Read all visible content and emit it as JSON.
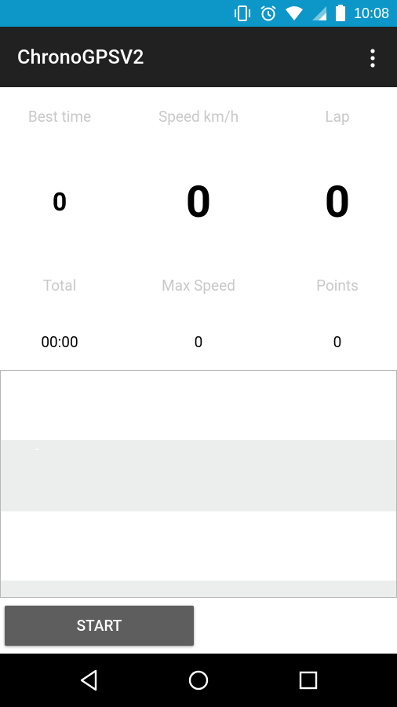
{
  "status_bar": {
    "time": "10:08",
    "icons": [
      "vibrate-icon",
      "alarm-icon",
      "wifi-icon",
      "signal-icon",
      "battery-icon"
    ]
  },
  "app_bar": {
    "title": "ChronoGPSV2",
    "menu_icon": "overflow-menu-icon"
  },
  "stats": {
    "best_time": {
      "label": "Best time",
      "value": "0"
    },
    "speed": {
      "label": "Speed km/h",
      "value": "0"
    },
    "lap": {
      "label": "Lap",
      "value": "0"
    },
    "total": {
      "label": "Total",
      "value": "00:00"
    },
    "max_speed": {
      "label": "Max Speed",
      "value": "0"
    },
    "points": {
      "label": "Points",
      "value": "0"
    }
  },
  "lap_list": {
    "rows": [
      "",
      "-",
      "",
      ""
    ]
  },
  "controls": {
    "start_label": "START"
  },
  "nav": {
    "back_icon": "back-icon",
    "home_icon": "home-icon",
    "recents_icon": "recents-icon"
  },
  "colors": {
    "status_bar": "#0d97c9",
    "app_bar": "#212121",
    "label_text": "#c9c9c9",
    "row_band": "#eceeed",
    "button": "#5e5e5f"
  }
}
